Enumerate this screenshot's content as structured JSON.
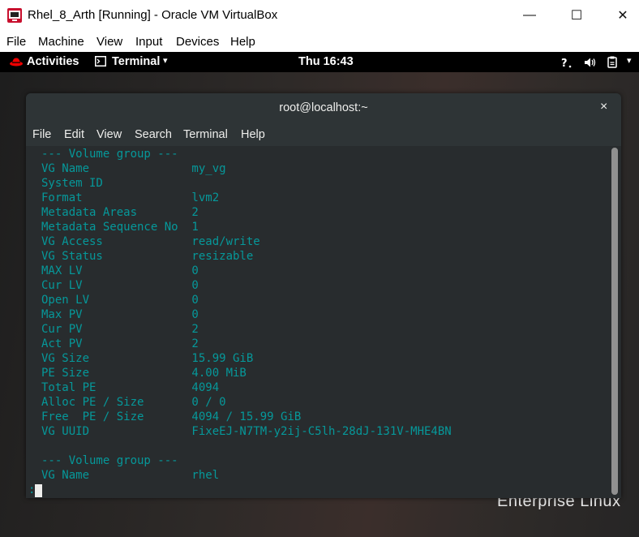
{
  "window": {
    "title": "Rhel_8_Arth [Running] - Oracle VM VirtualBox",
    "controls": {
      "minimize": "—",
      "maximize": "☐",
      "close": "✕"
    }
  },
  "vbox_menu": [
    "File",
    "Machine",
    "View",
    "Input",
    "Devices",
    "Help"
  ],
  "gnome_topbar": {
    "activities": "Activities",
    "app_name": "Terminal",
    "app_arrow": "▾",
    "clock": "Thu 16:43",
    "tray_icons": [
      "accessibility-icon",
      "volume-icon",
      "power-icon"
    ],
    "tray_arrow": "▾"
  },
  "terminal": {
    "title": "root@localhost:~",
    "close_glyph": "×",
    "menu": [
      "File",
      "Edit",
      "View",
      "Search",
      "Terminal",
      "Help"
    ],
    "lines": [
      "--- Volume group ---",
      "VG Name               my_vg",
      "System ID",
      "Format                lvm2",
      "Metadata Areas        2",
      "Metadata Sequence No  1",
      "VG Access             read/write",
      "VG Status             resizable",
      "MAX LV                0",
      "Cur LV                0",
      "Open LV               0",
      "Max PV                0",
      "Cur PV                2",
      "Act PV                2",
      "VG Size               15.99 GiB",
      "PE Size               4.00 MiB",
      "Total PE              4094",
      "Alloc PE / Size       0 / 0",
      "Free  PE / Size       4094 / 15.99 GiB",
      "VG UUID               FixeEJ-N7TM-y2ij-C5lh-28dJ-131V-MHE4BN",
      "",
      "--- Volume group ---",
      "VG Name               rhel"
    ],
    "prompt": ":"
  },
  "desktop": {
    "branding_text": "Enterprise Linux"
  },
  "colors": {
    "terminal_text": "#06989a",
    "terminal_bg": "#282c2e",
    "topbar_bg": "#000000",
    "redhat_red": "#ee0000"
  }
}
